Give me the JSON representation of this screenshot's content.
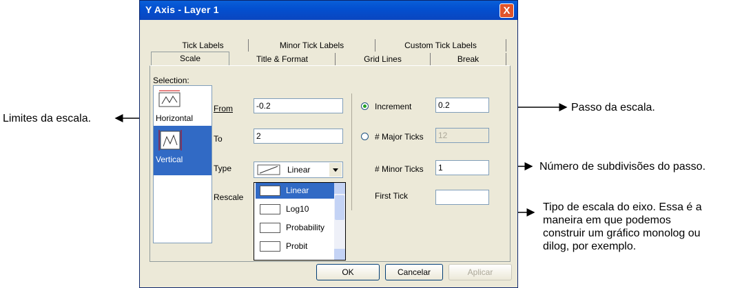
{
  "dialog": {
    "title": "Y Axis - Layer 1",
    "close_glyph": "X",
    "tabs_row1": [
      "Tick Labels",
      "Minor Tick Labels",
      "Custom Tick Labels"
    ],
    "tabs_row2": [
      "Scale",
      "Title & Format",
      "Grid Lines",
      "Break"
    ],
    "selection_label": "Selection:",
    "selection_items": [
      "Horizontal",
      "Vertical"
    ],
    "from_label": "From",
    "from_value": "-0.2",
    "to_label": "To",
    "to_value": "2",
    "type_label": "Type",
    "type_value": "Linear",
    "rescale_label": "Rescale",
    "type_options": [
      "Linear",
      "Log10",
      "Probability",
      "Probit"
    ],
    "increment_label": "Increment",
    "increment_value": "0.2",
    "major_ticks_label": "# Major Ticks",
    "major_ticks_value": "12",
    "minor_ticks_label": "# Minor Ticks",
    "minor_ticks_value": "1",
    "first_tick_label": "First Tick",
    "first_tick_value": "",
    "buttons": {
      "ok": "OK",
      "cancel": "Cancelar",
      "apply": "Aplicar"
    }
  },
  "annotations": {
    "limits": "Limites da escala.",
    "step": "Passo da escala.",
    "subdivisions": "Número de subdivisões do passo.",
    "scale_type": [
      "Tipo de escala do eixo. Essa é a",
      "maneira em que podemos",
      "construir um gráfico monolog ou",
      "dilog, por exemplo."
    ]
  },
  "colors": {
    "titlebar": "#0350d0",
    "selected": "#316ac5",
    "radio_dot": "#21a121"
  }
}
